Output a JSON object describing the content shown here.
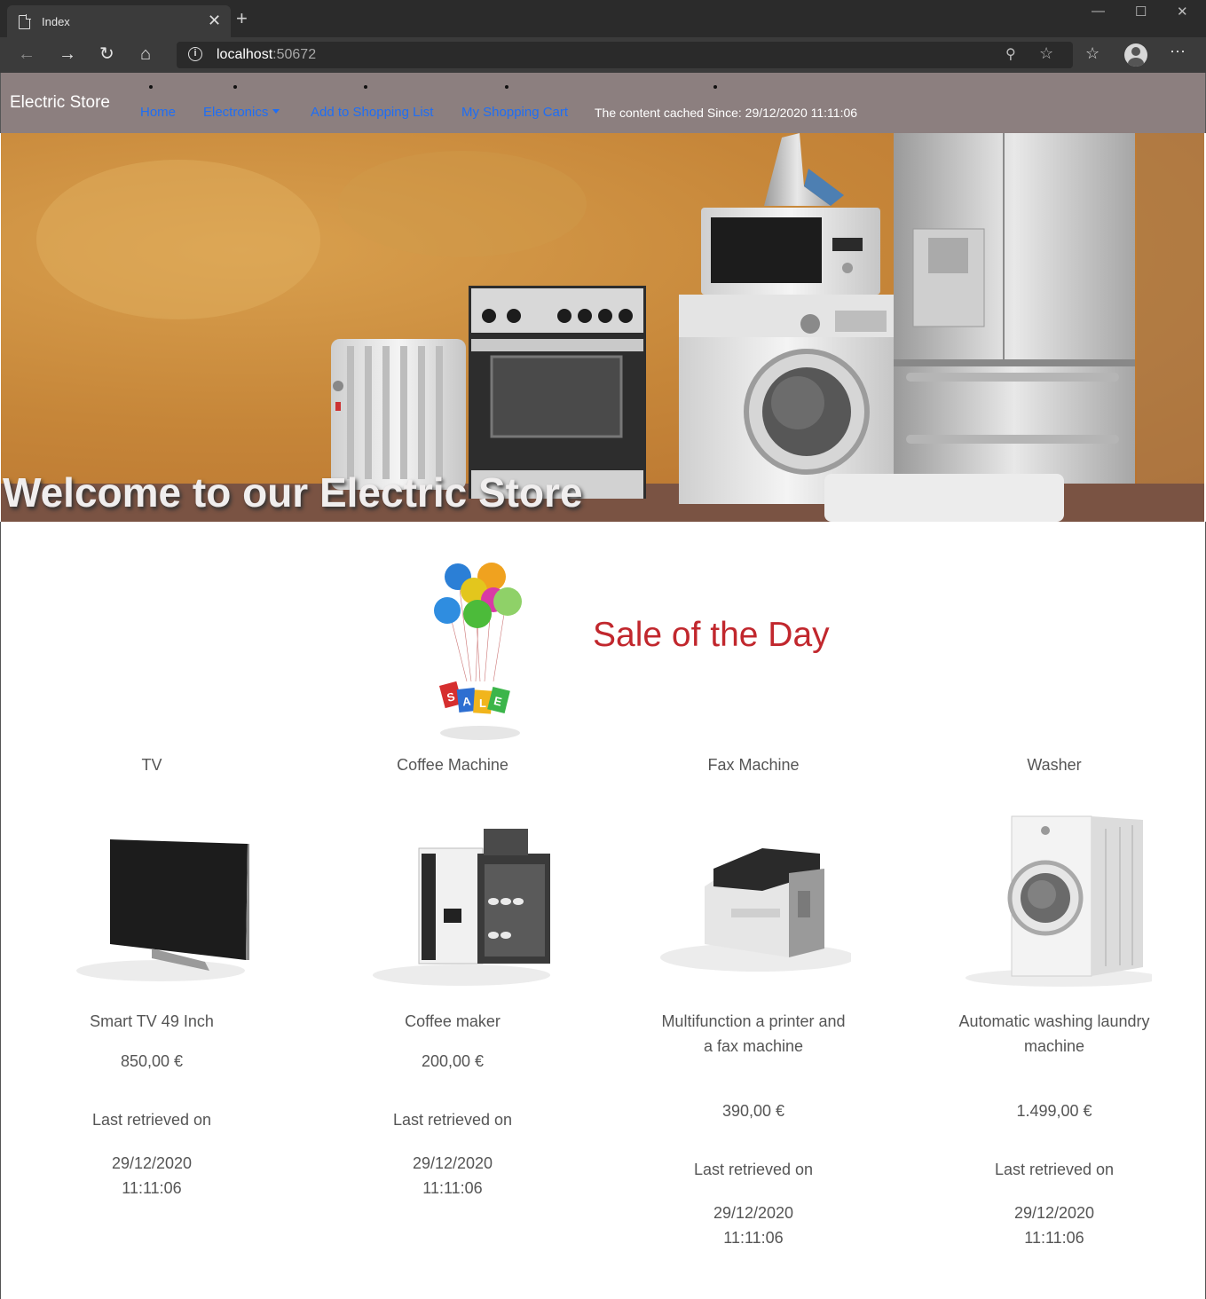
{
  "browser": {
    "tab_title": "Index",
    "url_host": "localhost",
    "url_port": ":50672"
  },
  "site": {
    "brand": "Electric Store",
    "nav": {
      "home": "Home",
      "electronics": "Electronics",
      "add_to_list": "Add to Shopping List",
      "cart": "My Shopping Cart"
    },
    "cached_text": "The content cached Since: 29/12/2020 11:11:06",
    "hero_title": "Welcome to our Electric Store",
    "sale_title": "Sale of the Day",
    "sale_graphic_letters": "SALE"
  },
  "products": [
    {
      "category": "TV",
      "name": "Smart TV 49 Inch",
      "price": "850,00 €",
      "last_retrieved_label": "Last retrieved on",
      "date": "29/12/2020",
      "time": "11:11:06"
    },
    {
      "category": "Coffee Machine",
      "name": "Coffee maker",
      "price": "200,00 €",
      "last_retrieved_label": "Last retrieved on",
      "date": "29/12/2020",
      "time": "11:11:06"
    },
    {
      "category": "Fax Machine",
      "name": "Multifunction a printer and a fax machine",
      "price": "390,00 €",
      "last_retrieved_label": "Last retrieved on",
      "date": "29/12/2020",
      "time": "11:11:06"
    },
    {
      "category": "Washer",
      "name": "Automatic washing laundry machine",
      "price": "1.499,00 €",
      "last_retrieved_label": "Last retrieved on",
      "date": "29/12/2020",
      "time": "11:11:06"
    }
  ],
  "colors": {
    "navbar_bg": "#8c7f7f",
    "nav_link": "#1e6ef5",
    "sale_title": "#c1272d"
  }
}
